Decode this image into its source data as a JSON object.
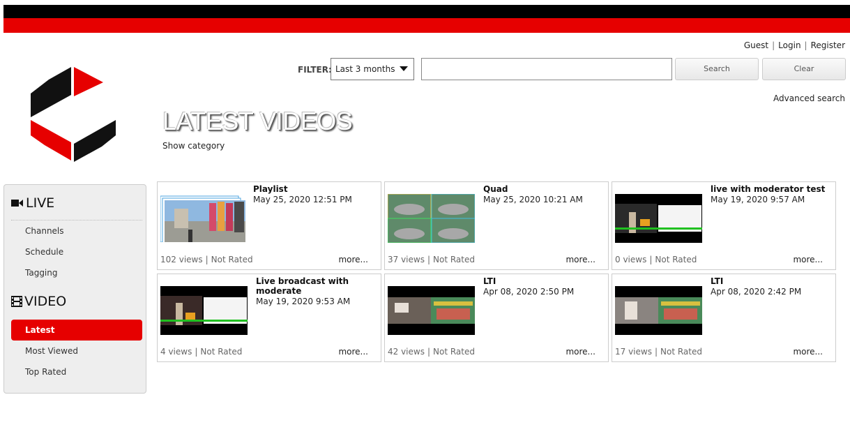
{
  "colors": {
    "brand_red": "#e60000",
    "brand_black": "#000000"
  },
  "user_links": [
    "Guest",
    "Login",
    "Register"
  ],
  "filter": {
    "label": "FILTER:",
    "selected": "Last 3 months",
    "search_placeholder": "",
    "search_button": "Search",
    "clear_button": "Clear",
    "advanced_search": "Advanced search"
  },
  "page": {
    "title": "LATEST VIDEOS",
    "show_category": "Show category"
  },
  "sidebar": {
    "live_heading": "LIVE",
    "live_icon": "video-camera-icon",
    "live_items": [
      "Channels",
      "Schedule",
      "Tagging"
    ],
    "video_heading": "VIDEO",
    "video_icon": "film-strip-icon",
    "video_items": [
      "Latest",
      "Most Viewed",
      "Top Rated"
    ],
    "active_item": "Latest"
  },
  "videos": [
    {
      "title": "Playlist",
      "date": "May 25, 2020 12:51 PM",
      "views": "102 views",
      "rating": "Not Rated",
      "more": "more..."
    },
    {
      "title": "Quad",
      "date": "May 25, 2020 10:21 AM",
      "views": "37 views",
      "rating": "Not Rated",
      "more": "more..."
    },
    {
      "title": "live with moderator test",
      "date": "May 19, 2020 9:57 AM",
      "views": "0 views",
      "rating": "Not Rated",
      "more": "more..."
    },
    {
      "title": "Live broadcast with moderate",
      "date": "May 19, 2020 9:53 AM",
      "views": "4 views",
      "rating": "Not Rated",
      "more": "more..."
    },
    {
      "title": "LTI",
      "date": "Apr 08, 2020 2:50 PM",
      "views": "42 views",
      "rating": "Not Rated",
      "more": "more..."
    },
    {
      "title": "LTI",
      "date": "Apr 08, 2020 2:42 PM",
      "views": "17 views",
      "rating": "Not Rated",
      "more": "more..."
    }
  ]
}
